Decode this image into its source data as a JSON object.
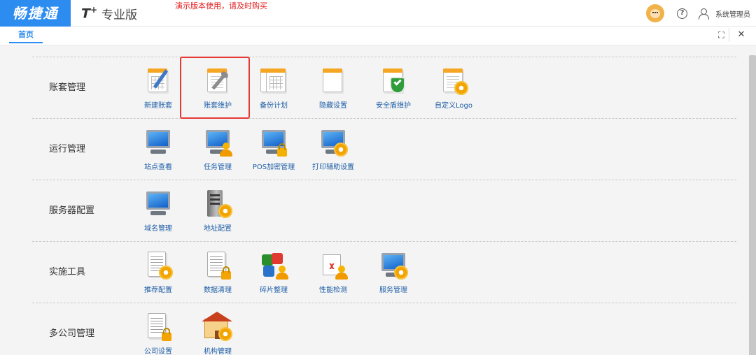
{
  "header": {
    "logo_text": "畅捷通",
    "product_mark": "T",
    "product_mark_sup": "+",
    "product_name": "专业版",
    "demo_note": "演示版本使用，请及时购买",
    "user_name": "系统管理员"
  },
  "tabs": [
    {
      "label": "首页",
      "active": true
    }
  ],
  "sections": [
    {
      "title": "账套管理",
      "items": [
        {
          "label": "新建账套",
          "icon": "new-account-set-icon"
        },
        {
          "label": "账套维护",
          "icon": "account-set-maintenance-icon",
          "highlighted": true
        },
        {
          "label": "备份计划",
          "icon": "backup-plan-icon"
        },
        {
          "label": "隐藏设置",
          "icon": "hidden-settings-icon"
        },
        {
          "label": "安全盾维护",
          "icon": "security-shield-icon"
        },
        {
          "label": "自定义Logo",
          "icon": "custom-logo-icon"
        }
      ]
    },
    {
      "title": "运行管理",
      "items": [
        {
          "label": "站点查看",
          "icon": "site-view-icon"
        },
        {
          "label": "任务管理",
          "icon": "task-management-icon"
        },
        {
          "label": "POS加密管理",
          "icon": "pos-encryption-icon"
        },
        {
          "label": "打印辅助设置",
          "icon": "print-assist-settings-icon"
        }
      ]
    },
    {
      "title": "服务器配置",
      "items": [
        {
          "label": "域名管理",
          "icon": "domain-management-icon"
        },
        {
          "label": "地址配置",
          "icon": "address-config-icon"
        }
      ]
    },
    {
      "title": "实施工具",
      "items": [
        {
          "label": "推荐配置",
          "icon": "recommended-config-icon"
        },
        {
          "label": "数据清理",
          "icon": "data-cleanup-icon"
        },
        {
          "label": "碎片整理",
          "icon": "defragment-icon"
        },
        {
          "label": "性能检测",
          "icon": "performance-check-icon"
        },
        {
          "label": "服务管理",
          "icon": "service-management-icon"
        }
      ]
    },
    {
      "title": "多公司管理",
      "items": [
        {
          "label": "公司设置",
          "icon": "company-settings-icon"
        },
        {
          "label": "机构管理",
          "icon": "organization-management-icon"
        }
      ]
    }
  ],
  "colors": {
    "brand": "#2d8cf0",
    "label": "#1f5fa8",
    "highlight": "#e53935",
    "demo_note": "#e02020"
  }
}
